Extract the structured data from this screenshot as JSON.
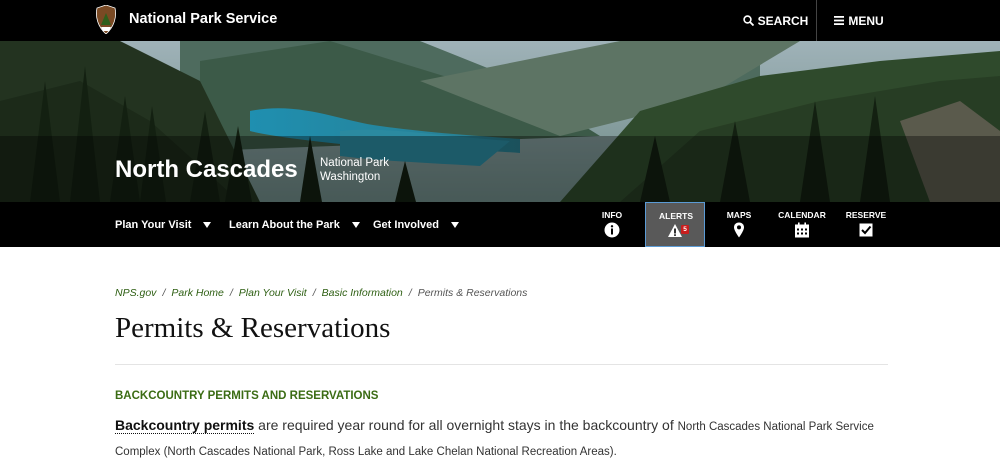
{
  "header": {
    "site_title": "National Park Service",
    "search_label": "SEARCH",
    "menu_label": "MENU",
    "logo_icon": "nps-arrowhead-icon"
  },
  "hero": {
    "park_name": "North Cascades",
    "park_type": "National Park",
    "park_state": "Washington"
  },
  "nav": {
    "items": [
      {
        "label": "Plan Your Visit"
      },
      {
        "label": "Learn About the Park"
      },
      {
        "label": "Get Involved"
      }
    ],
    "tools": [
      {
        "label": "INFO",
        "icon": "info-icon"
      },
      {
        "label": "ALERTS",
        "icon": "alert-icon",
        "badge": "5",
        "active": true
      },
      {
        "label": "MAPS",
        "icon": "map-pin-icon"
      },
      {
        "label": "CALENDAR",
        "icon": "calendar-icon"
      },
      {
        "label": "RESERVE",
        "icon": "checkbox-icon"
      }
    ]
  },
  "breadcrumb": {
    "items": [
      "NPS.gov",
      "Park Home",
      "Plan Your Visit",
      "Basic Information",
      "Permits & Reservations"
    ],
    "separator": "/"
  },
  "main": {
    "title": "Permits & Reservations",
    "section_heading": "BACKCOUNTRY PERMITS AND RESERVATIONS",
    "para_link": "Backcountry permits",
    "para_text_1": " are required year round for all overnight stays in the backcountry of ",
    "para_text_2": "North Cascades National Park Service Complex (North Cascades National Park, Ross Lake and Lake Chelan National Recreation Areas)."
  },
  "colors": {
    "header_bg": "#000000",
    "heading_green": "#3b6c14",
    "alert_red": "#c81e1e"
  }
}
